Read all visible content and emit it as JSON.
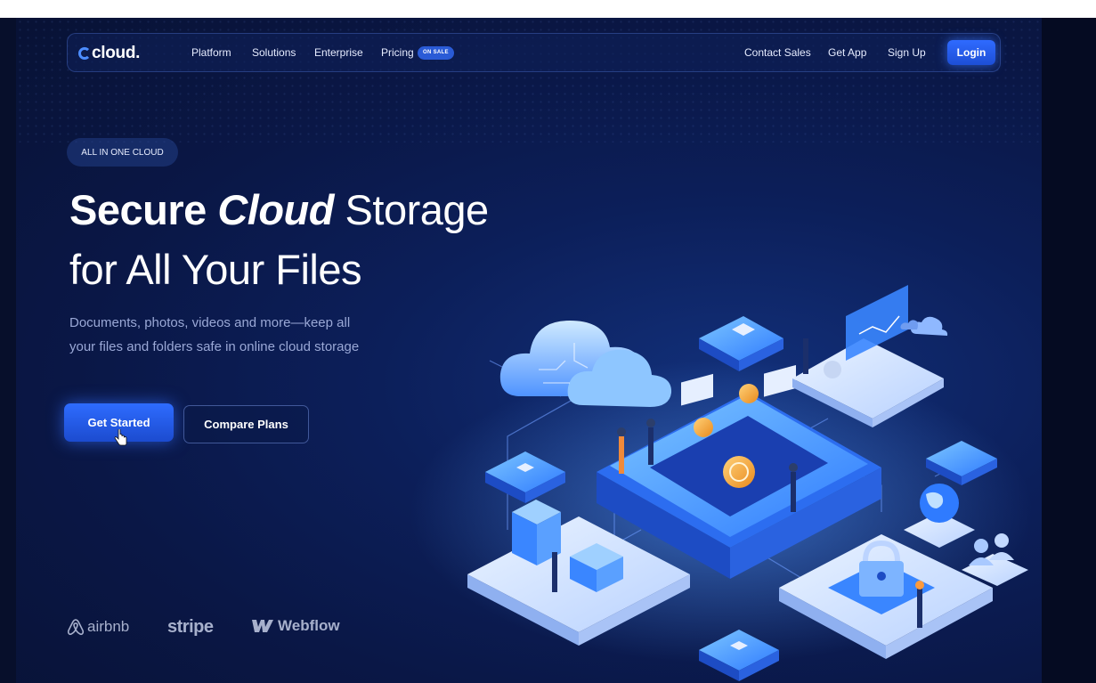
{
  "nav": {
    "logo": "cloud.",
    "links": [
      "Platform",
      "Solutions",
      "Enterprise",
      "Pricing"
    ],
    "sale_badge": "ON SALE",
    "contact": "Contact Sales",
    "get_app": "Get App",
    "sign_up": "Sign Up",
    "login": "Login"
  },
  "hero": {
    "pill": "ALL IN ONE CLOUD",
    "title_part1": "Secure",
    "title_part2": "Cloud",
    "title_part3": "Storage",
    "title_line2": "for All Your Files",
    "subtitle_line1": "Documents, photos, videos and more—keep all",
    "subtitle_line2": "your files and folders safe in online cloud storage",
    "cta_primary": "Get Started",
    "cta_secondary": "Compare Plans"
  },
  "brands": [
    "airbnb",
    "stripe",
    "Webflow"
  ],
  "colors": {
    "background": "#0a1746",
    "accent": "#2e6cff",
    "text_primary": "#ffffff",
    "text_secondary": "#9aa8d6"
  },
  "icons": [
    "airbnb-logo-icon",
    "webflow-logo-icon",
    "pointer-cursor-icon",
    "cloud-icon",
    "padlock-icon",
    "globe-icon"
  ]
}
